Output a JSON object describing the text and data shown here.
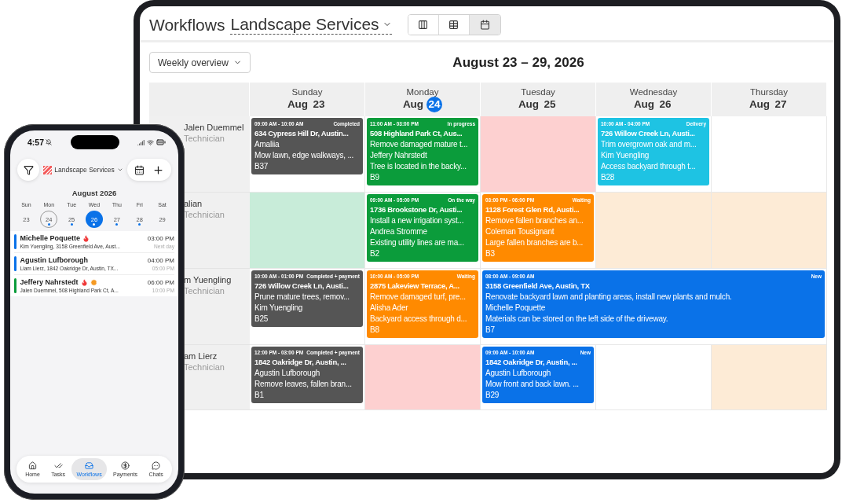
{
  "tablet": {
    "title": "Workflows",
    "workspace": "Landscape Services",
    "view_switcher": [
      {
        "selected": false
      },
      {
        "selected": false
      },
      {
        "selected": true
      }
    ],
    "range_select": "Weekly overview",
    "range_title": "August 23 – 29, 2026",
    "days": [
      {
        "weekday": "Sunday",
        "date": "Aug",
        "day": "23",
        "today": false
      },
      {
        "weekday": "Monday",
        "date": "Aug",
        "day": "24",
        "today": true
      },
      {
        "weekday": "Tuesday",
        "date": "Aug",
        "day": "25",
        "today": false
      },
      {
        "weekday": "Wednesday",
        "date": "Aug",
        "day": "26",
        "today": false
      },
      {
        "weekday": "Thursday",
        "date": "Aug",
        "day": "27",
        "today": false
      }
    ],
    "rows": [
      {
        "name": "Jalen Duemmel",
        "role": "Technician",
        "cells": [
          {
            "event": {
              "time": "09:00 AM - 10:00 AM",
              "status": "Completed",
              "color": "#555555",
              "address": "634 Cypress Hill Dr, Austin...",
              "lines": [
                "Amaliia",
                "Mow lawn, edge walkways, ..."
              ],
              "code": "B37"
            }
          },
          {
            "event": {
              "time": "11:00 AM - 03:00 PM",
              "status": "In progress",
              "color": "#0b9c3b",
              "address": "508 Highland Park Ct, Aus...",
              "lines": [
                "Remove damaged mature t...",
                "Jeffery Nahrstedt",
                "Tree is located in the backy..."
              ],
              "code": "B9"
            }
          },
          {
            "color": "#fdd0d0"
          },
          {
            "event": {
              "time": "10:00 AM - 04:00 PM",
              "status": "Delivery",
              "color": "#1ec3e3",
              "address": "726 Willow Creek Ln, Austi...",
              "lines": [
                "Trim overgrown oak and m...",
                "Kim Yuengling",
                "Access backyard through t..."
              ],
              "code": "B28"
            }
          },
          {
            "color": "#ffffff"
          }
        ]
      },
      {
        "name": "alian",
        "role": "Technician",
        "cells": [
          {
            "color": "#c8ecd9"
          },
          {
            "event": {
              "time": "09:00 AM - 05:00 PM",
              "status": "On the way",
              "color": "#0b9c3b",
              "address": "1736 Brookstone Dr, Austi...",
              "lines": [
                "Install a new irrigation syst...",
                "Andrea Stromme",
                "Existing utility lines are ma..."
              ],
              "code": "B2"
            }
          },
          {
            "event": {
              "time": "03:00 PM - 06:00 PM",
              "status": "Waiting",
              "color": "#ff8a00",
              "address": "1128 Forest Glen Rd, Austi...",
              "lines": [
                "Remove fallen branches an...",
                "Coleman Tousignant",
                "Large fallen branches are b..."
              ],
              "code": "B3"
            }
          },
          {
            "color": "#fdebd6"
          },
          {
            "color": "#fdebd6"
          }
        ]
      },
      {
        "name": "m Yuengling",
        "role": "Technician",
        "cells": [
          {
            "event": {
              "time": "10:00 AM - 01:00 PM",
              "status": "Completed + payment",
              "color": "#555555",
              "address": "726 Willow Creek Ln, Austi...",
              "lines": [
                "Prune mature trees, remov...",
                "Kim Yuengling"
              ],
              "code": "B25"
            }
          },
          {
            "event": {
              "time": "10:00 AM - 05:00 PM",
              "status": "Waiting",
              "color": "#ff8a00",
              "address": "2875 Lakeview Terrace, A...",
              "lines": [
                "Remove damaged turf, pre...",
                "Alisha Ader",
                "Backyard access through d..."
              ],
              "code": "B8"
            }
          },
          {
            "extends": true,
            "event": {
              "time": "08:00 AM - 09:00 AM",
              "status": "New",
              "color": "#0a72e8",
              "address": "3158 Greenfield Ave, Austin, TX",
              "lines": [
                "Renovate backyard lawn and planting areas, install new plants and mulch.",
                "Michelle Poquette",
                "Materials can be stored on the left side of the driveway."
              ],
              "code": "B7"
            }
          }
        ]
      },
      {
        "name": "am Lierz",
        "role": "Technician",
        "cells": [
          {
            "event": {
              "time": "12:00 PM - 03:00 PM",
              "status": "Completed + payment",
              "color": "#555555",
              "address": "1842 Oakridge Dr, Austin, ...",
              "lines": [
                "Agustin Lufborough",
                "Remove leaves, fallen bran..."
              ],
              "code": "B1"
            }
          },
          {
            "color": "#fdd0d0"
          },
          {
            "event": {
              "time": "09:00 AM - 10:00 AM",
              "status": "New",
              "color": "#0a72e8",
              "address": "1842 Oakridge Dr, Austin, ...",
              "lines": [
                "Agustin Lufborough",
                "Mow front and back lawn. ..."
              ],
              "code": "B29"
            }
          },
          {
            "color": "#ffffff"
          },
          {
            "color": "#fdebd6"
          }
        ]
      }
    ]
  },
  "phone": {
    "time": "4:57",
    "workspace": "Landscape Services",
    "month": "August 2026",
    "week": [
      {
        "weekday": "Sun",
        "day": "23",
        "today": false,
        "selected": false,
        "has_events": false
      },
      {
        "weekday": "Mon",
        "day": "24",
        "today": true,
        "selected": false,
        "has_events": true
      },
      {
        "weekday": "Tue",
        "day": "25",
        "today": false,
        "selected": false,
        "has_events": true
      },
      {
        "weekday": "Wed",
        "day": "26",
        "today": false,
        "selected": true,
        "has_events": true
      },
      {
        "weekday": "Thu",
        "day": "27",
        "today": false,
        "selected": false,
        "has_events": true
      },
      {
        "weekday": "Fri",
        "day": "28",
        "today": false,
        "selected": false,
        "has_events": true
      },
      {
        "weekday": "Sat",
        "day": "29",
        "today": false,
        "selected": false,
        "has_events": false
      }
    ],
    "items": [
      {
        "title": "Michelle Poquette",
        "urgent": true,
        "start": "03:00 PM",
        "subtitle": "Kim Yuengling, 3158 Greenfield Ave, Aust...",
        "end": "Next day",
        "color": "#0a72e8"
      },
      {
        "title": "Agustin Lufborough",
        "start": "04:00 PM",
        "subtitle": "Liam Lierz, 1842 Oakridge Dr, Austin, TX...",
        "end": "05:00 PM",
        "color": "#0a72e8"
      },
      {
        "title": "Jeffery Nahrstedt",
        "urgent": true,
        "late": true,
        "start": "06:00 PM",
        "subtitle": "Jalen Duemmel, 508 Highland Park Ct, A...",
        "end": "10:00 PM",
        "color": "#0b9c3b"
      }
    ],
    "tabs": [
      {
        "label": "Home",
        "selected": false
      },
      {
        "label": "Tasks",
        "selected": false
      },
      {
        "label": "Workflows",
        "selected": true
      },
      {
        "label": "Payments",
        "selected": false
      },
      {
        "label": "Chats",
        "selected": false
      }
    ]
  }
}
